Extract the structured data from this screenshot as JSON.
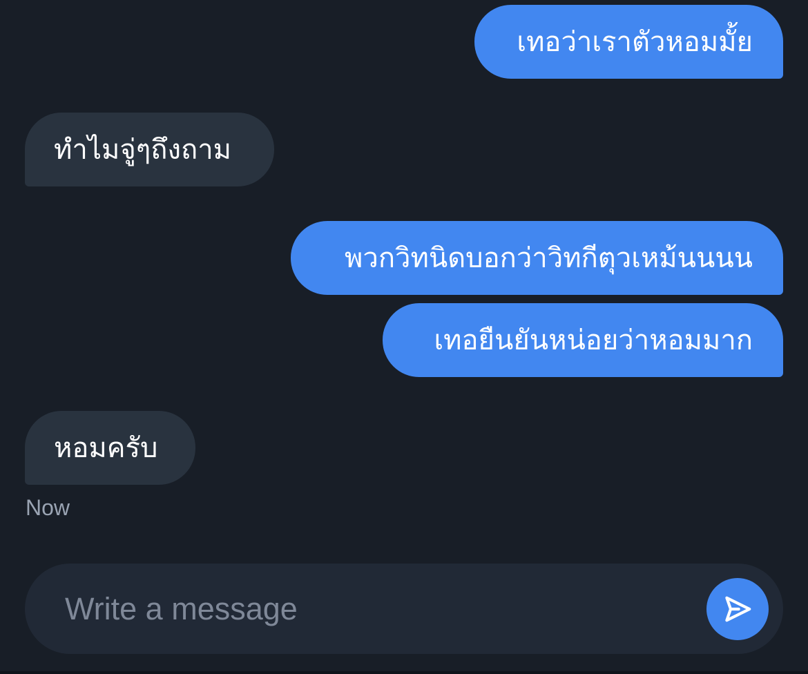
{
  "messages": [
    {
      "direction": "outgoing",
      "text": "เทอว่าเราตัวหอมมั้ย"
    },
    {
      "direction": "incoming",
      "text": "ทำไมจู่ๆถึงถาม"
    },
    {
      "direction": "outgoing",
      "text": "พวกวิทนิดบอกว่าวิทกีตุวเหม้นนนน"
    },
    {
      "direction": "outgoing",
      "text": "เทอยืนยันหน่อยว่าหอมมาก"
    },
    {
      "direction": "incoming",
      "text": "หอมครับ"
    }
  ],
  "timestamp": "Now",
  "composer": {
    "placeholder": "Write a message",
    "send_icon": "send-icon"
  },
  "colors": {
    "background": "#181e27",
    "outgoing_bubble": "#4287f0",
    "incoming_bubble": "#29333f",
    "composer": "#212936",
    "timestamp": "#9aa4b3"
  }
}
